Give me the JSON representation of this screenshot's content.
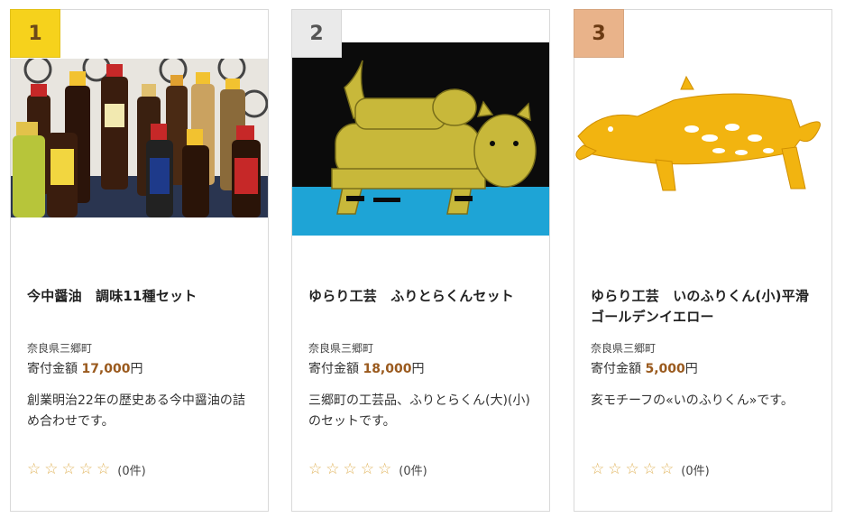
{
  "products": [
    {
      "rank": "1",
      "title": "今中醤油　調味11種セット",
      "region": "奈良県三郷町",
      "price_label": "寄付金額",
      "price_amount": "17,000",
      "price_unit": "円",
      "description": "創業明治22年の歴史ある今中醤油の詰め合わせです。",
      "rating_count": "(0件)",
      "image_icon": "soy-sauce-bottles-photo"
    },
    {
      "rank": "2",
      "title": "ゆらり工芸　ふりとらくんセット",
      "region": "奈良県三郷町",
      "price_label": "寄付金額",
      "price_amount": "18,000",
      "price_unit": "円",
      "description": "三郷町の工芸品、ふりとらくん(大)(小)のセットです。",
      "rating_count": "(0件)",
      "image_icon": "yellow-tiger-craft-photo"
    },
    {
      "rank": "3",
      "title": "ゆらり工芸　いのふりくん(小)平滑ゴールデンイエロー",
      "region": "奈良県三郷町",
      "price_label": "寄付金額",
      "price_amount": "5,000",
      "price_unit": "円",
      "description": "亥モチーフの«いのふりくん»です。",
      "rating_count": "(0件)",
      "image_icon": "yellow-boar-craft-photo"
    }
  ],
  "star_glyph": "☆",
  "colors": {
    "rank1": "#f6d21c",
    "rank2": "#eaeaea",
    "rank3": "#e9b38a",
    "price": "#9a5a1e",
    "star": "#e0b35a"
  }
}
